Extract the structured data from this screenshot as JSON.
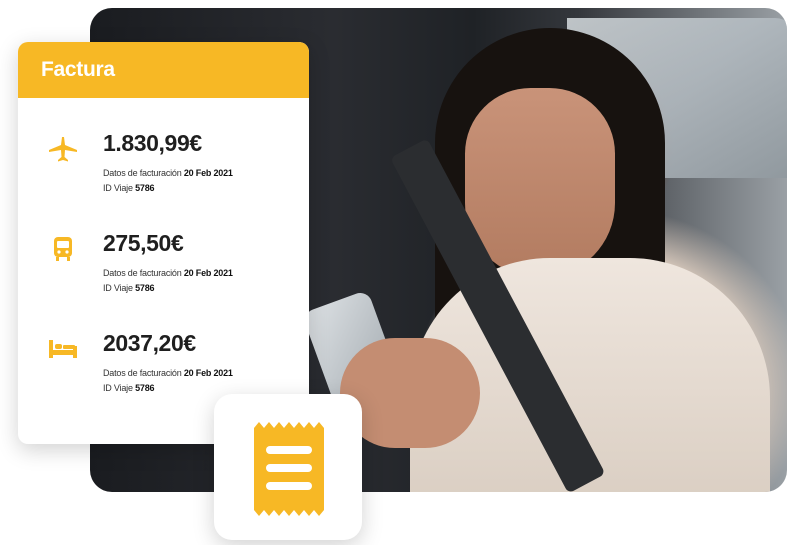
{
  "card": {
    "title": "Factura",
    "items": [
      {
        "icon": "airplane-icon",
        "amount": "1.830,99€",
        "date_label": "Datos de facturación",
        "date_value": "20 Feb 2021",
        "id_label": "ID Viaje",
        "id_value": "5786"
      },
      {
        "icon": "train-icon",
        "amount": "275,50€",
        "date_label": "Datos de facturación",
        "date_value": "20 Feb 2021",
        "id_label": "ID Viaje",
        "id_value": "5786"
      },
      {
        "icon": "bed-icon",
        "amount": "2037,20€",
        "date_label": "Datos de facturación",
        "date_value": "20 Feb 2021",
        "id_label": "ID Viaje",
        "id_value": "5786"
      }
    ]
  },
  "receipt_badge": {
    "icon": "receipt-icon"
  },
  "colors": {
    "accent": "#f7b825",
    "text": "#1f1f1f"
  }
}
